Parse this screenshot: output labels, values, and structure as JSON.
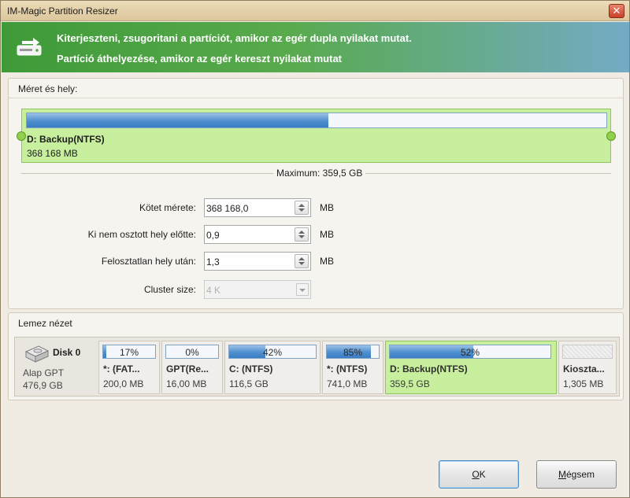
{
  "window": {
    "title": "IM-Magic Partition Resizer",
    "close_label": "✕"
  },
  "banner": {
    "line1": "Kiterjeszteni, zsugoritani a partíciót, amikor az egér dupla nyilakat mutat.",
    "line2": "Partíció áthelyezése, amikor az egér kereszt nyilakat mutat",
    "icon": "drive-move-icon"
  },
  "size_group": {
    "title": "Méret és hely:",
    "partition": {
      "name": "D: Backup(NTFS)",
      "size": "368 168 MB",
      "used_fraction": 0.52
    },
    "maximum": "Maximum: 359,5 GB",
    "fields": [
      {
        "label": "Kötet mérete:",
        "value": "368 168,0",
        "unit": "MB"
      },
      {
        "label": "Ki nem osztott hely előtte:",
        "value": "0,9",
        "unit": "MB"
      },
      {
        "label": "Felosztatlan hely után:",
        "value": "1,3",
        "unit": "MB"
      },
      {
        "label": "Cluster size:",
        "value": "4 K",
        "unit": ""
      }
    ]
  },
  "disk_group": {
    "title": "Lemez nézet",
    "disk": {
      "name": "Disk 0",
      "type": "Alap GPT",
      "size": "476,9 GB",
      "icon": "hard-disk-icon"
    },
    "partitions": [
      {
        "pct": "17%",
        "fill": 0.06,
        "name": "*: (FAT...",
        "size": "200,0 MB"
      },
      {
        "pct": "0%",
        "fill": 0.0,
        "name": "GPT(Re...",
        "size": "16,00 MB"
      },
      {
        "pct": "42%",
        "fill": 0.42,
        "name": "C: (NTFS)",
        "size": "116,5 GB"
      },
      {
        "pct": "85%",
        "fill": 0.85,
        "name": "*: (NTFS)",
        "size": "741,0 MB"
      },
      {
        "pct": "52%",
        "fill": 0.52,
        "name": "D: Backup(NTFS)",
        "size": "359,5 GB"
      },
      {
        "pct": "",
        "fill": 0.0,
        "name": "Kioszta...",
        "size": "1,305 MB"
      }
    ]
  },
  "buttons": {
    "ok_mnemonic": "O",
    "ok_rest": "K",
    "cancel_mnemonic": "M",
    "cancel_rest": "égsem"
  },
  "colors": {
    "accent_green": "#8fc460",
    "selected_fill": "#c7ef9e",
    "bar_blue": "#4f8fcf"
  }
}
